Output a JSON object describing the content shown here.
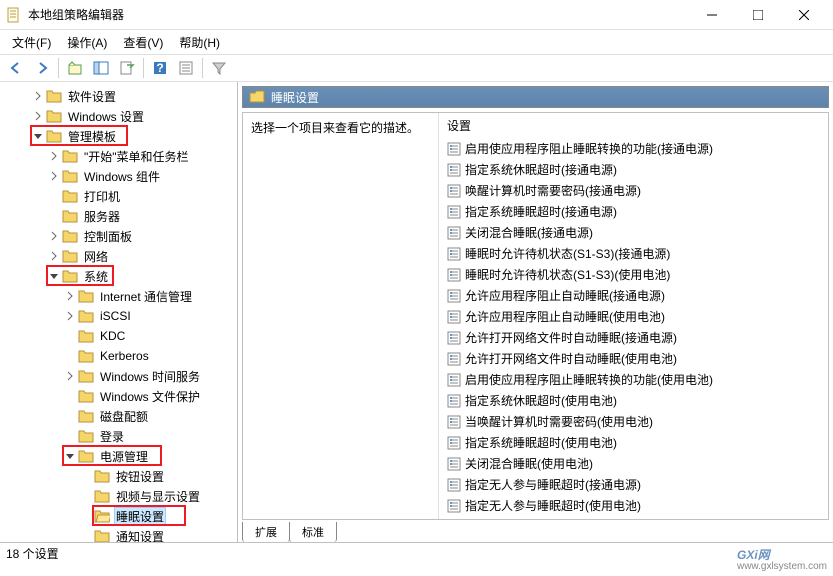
{
  "window": {
    "title": "本地组策略编辑器",
    "minimize": "—",
    "maximize": "□",
    "close": "✕"
  },
  "menu": {
    "file": "文件(F)",
    "action": "操作(A)",
    "view": "查看(V)",
    "help": "帮助(H)"
  },
  "tree": [
    {
      "label": "软件设置",
      "indent": 2,
      "expander": ">"
    },
    {
      "label": "Windows 设置",
      "indent": 2,
      "expander": ">"
    },
    {
      "label": "管理模板",
      "indent": 2,
      "expander": "v",
      "red": true
    },
    {
      "label": "\"开始\"菜单和任务栏",
      "indent": 3,
      "expander": ">"
    },
    {
      "label": "Windows 组件",
      "indent": 3,
      "expander": ">"
    },
    {
      "label": "打印机",
      "indent": 3,
      "expander": ""
    },
    {
      "label": "服务器",
      "indent": 3,
      "expander": ""
    },
    {
      "label": "控制面板",
      "indent": 3,
      "expander": ">"
    },
    {
      "label": "网络",
      "indent": 3,
      "expander": ">"
    },
    {
      "label": "系统",
      "indent": 3,
      "expander": "v",
      "red": true
    },
    {
      "label": "Internet 通信管理",
      "indent": 4,
      "expander": ">"
    },
    {
      "label": "iSCSI",
      "indent": 4,
      "expander": ">"
    },
    {
      "label": "KDC",
      "indent": 4,
      "expander": ""
    },
    {
      "label": "Kerberos",
      "indent": 4,
      "expander": ""
    },
    {
      "label": "Windows 时间服务",
      "indent": 4,
      "expander": ">"
    },
    {
      "label": "Windows 文件保护",
      "indent": 4,
      "expander": ""
    },
    {
      "label": "磁盘配额",
      "indent": 4,
      "expander": ""
    },
    {
      "label": "登录",
      "indent": 4,
      "expander": ""
    },
    {
      "label": "电源管理",
      "indent": 4,
      "expander": "v",
      "red": true
    },
    {
      "label": "按钮设置",
      "indent": 5,
      "expander": ""
    },
    {
      "label": "视频与显示设置",
      "indent": 5,
      "expander": ""
    },
    {
      "label": "睡眠设置",
      "indent": 5,
      "expander": "",
      "selected": true,
      "red": true
    },
    {
      "label": "通知设置",
      "indent": 5,
      "expander": ""
    }
  ],
  "detail": {
    "header": "睡眠设置",
    "desc_prompt": "选择一个项目来查看它的描述。",
    "settings_header": "设置",
    "settings": [
      "启用使应用程序阻止睡眠转换的功能(接通电源)",
      "指定系统休眠超时(接通电源)",
      "唤醒计算机时需要密码(接通电源)",
      "指定系统睡眠超时(接通电源)",
      "关闭混合睡眠(接通电源)",
      "睡眠时允许待机状态(S1-S3)(接通电源)",
      "睡眠时允许待机状态(S1-S3)(使用电池)",
      "允许应用程序阻止自动睡眠(接通电源)",
      "允许应用程序阻止自动睡眠(使用电池)",
      "允许打开网络文件时自动睡眠(接通电源)",
      "允许打开网络文件时自动睡眠(使用电池)",
      "启用使应用程序阻止睡眠转换的功能(使用电池)",
      "指定系统休眠超时(使用电池)",
      "当唤醒计算机时需要密码(使用电池)",
      "指定系统睡眠超时(使用电池)",
      "关闭混合睡眠(使用电池)",
      "指定无人参与睡眠超时(接通电源)",
      "指定无人参与睡眠超时(使用电池)"
    ]
  },
  "tabs": {
    "extended": "扩展",
    "standard": "标准"
  },
  "statusbar": {
    "text": "18 个设置"
  },
  "watermark": {
    "main": "GXi网",
    "sub": "www.gxlsystem.com"
  }
}
